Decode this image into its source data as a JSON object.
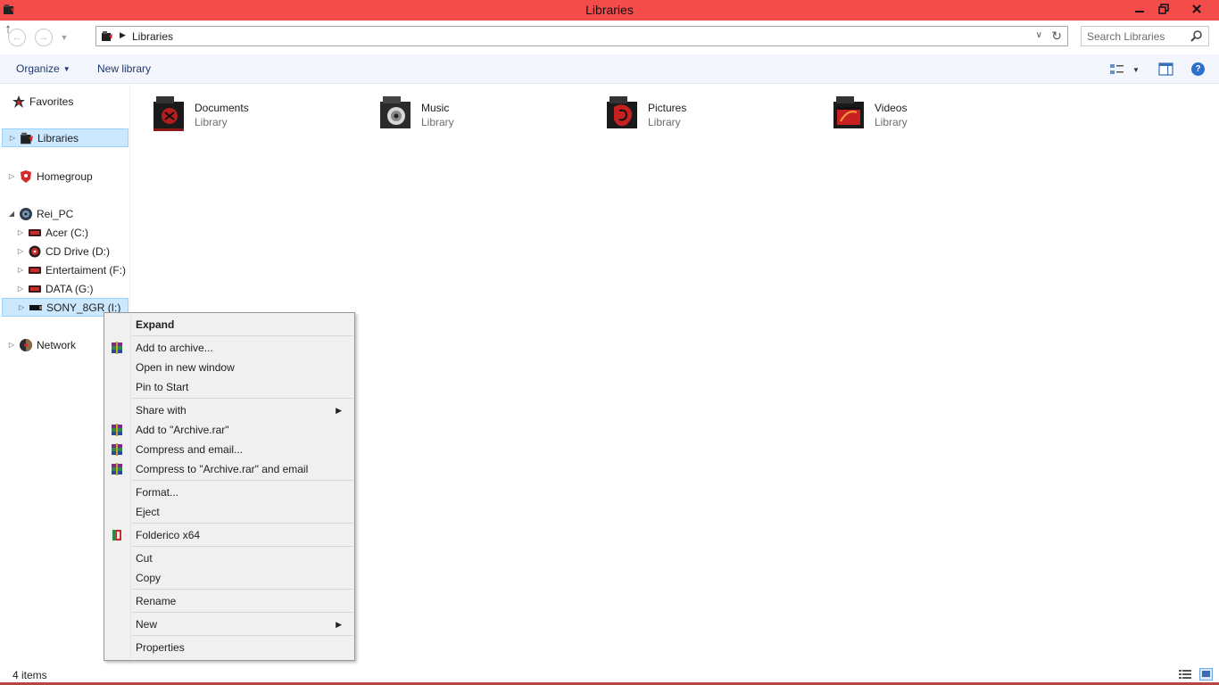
{
  "window": {
    "title": "Libraries",
    "accent_color": "#f44b4b"
  },
  "address": {
    "crumb": "Libraries",
    "search_placeholder": "Search Libraries"
  },
  "toolbar": {
    "organize_label": "Organize",
    "new_library_label": "New library"
  },
  "nav": {
    "favorites": "Favorites",
    "libraries": "Libraries",
    "homegroup": "Homegroup",
    "pc": "Rei_PC",
    "drives": [
      {
        "label": "Acer (C:)",
        "icon": "hard-drive-icon"
      },
      {
        "label": "CD Drive (D:)",
        "icon": "cd-drive-icon"
      },
      {
        "label": "Entertaiment (F:)",
        "icon": "hard-drive-icon"
      },
      {
        "label": "DATA (G:)",
        "icon": "hard-drive-icon"
      },
      {
        "label": "SONY_8GR (I:)",
        "icon": "usb-drive-icon"
      }
    ],
    "network": "Network"
  },
  "libraries": [
    {
      "name": "Documents",
      "type": "Library",
      "icon": "documents-library-icon"
    },
    {
      "name": "Music",
      "type": "Library",
      "icon": "music-library-icon"
    },
    {
      "name": "Pictures",
      "type": "Library",
      "icon": "pictures-library-icon"
    },
    {
      "name": "Videos",
      "type": "Library",
      "icon": "videos-library-icon"
    }
  ],
  "context_menu": {
    "expand": "Expand",
    "add_to_archive": "Add to archive...",
    "open_new_window": "Open in new window",
    "pin_to_start": "Pin to Start",
    "share_with": "Share with",
    "add_to_rar": "Add to \"Archive.rar\"",
    "compress_email": "Compress and email...",
    "compress_rar_email": "Compress to \"Archive.rar\" and email",
    "format": "Format...",
    "eject": "Eject",
    "folderico": "Folderico x64",
    "cut": "Cut",
    "copy": "Copy",
    "rename": "Rename",
    "new": "New",
    "properties": "Properties"
  },
  "status": {
    "item_count": "4 items"
  }
}
